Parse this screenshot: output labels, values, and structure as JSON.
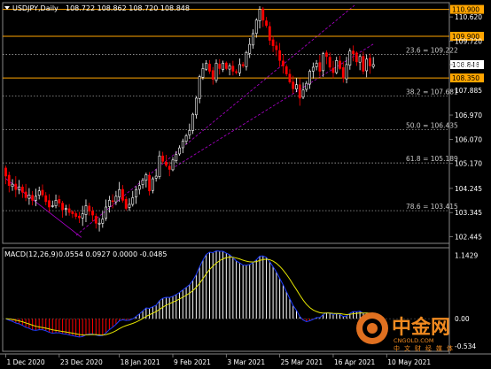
{
  "header": {
    "symbol": "USDJPY,Daily",
    "ohlc": "108.722 108.862 108.720 108.848"
  },
  "macd_header": {
    "label": "MACD(12,26,9)",
    "values": "0.0554 0.0927 0.0000 -0.0485"
  },
  "watermark": {
    "brand": "中金网",
    "domain": "CNGOLD.COM",
    "tagline": "中文财经媒体"
  },
  "colors": {
    "background": "#000000",
    "bull_candle": "#ffffff",
    "bear_candle": "#ff0000",
    "level_line": "#ffa500",
    "channel": "#b000d0",
    "macd_line": "#1e3cff",
    "signal_line": "#e6e600",
    "hist_pos": "#ffffff",
    "hist_neg": "#ff0000"
  },
  "chart_data": {
    "type": "candlestick",
    "symbol": "USDJPY",
    "timeframe": "Daily",
    "ylim": [
      102.2,
      111.15
    ],
    "price_axis_ticks": [
      "110.620",
      "109.720",
      "108.848",
      "107.885",
      "106.970",
      "106.070",
      "105.170",
      "104.245",
      "103.345",
      "102.445"
    ],
    "x_ticks": [
      "1 Dec 2020",
      "23 Dec 2020",
      "18 Jan 2021",
      "9 Feb 2021",
      "3 Mar 2021",
      "25 Mar 2021",
      "16 Apr 2021",
      "10 May 2021"
    ],
    "current_price": "108.848",
    "horizontal_levels": [
      {
        "value": 110.9,
        "label": "110.900"
      },
      {
        "value": 109.9,
        "label": "109.900"
      },
      {
        "value": 108.35,
        "label": "108.350"
      }
    ],
    "fibonacci_levels": [
      {
        "ratio": "23.6",
        "value": 109.222,
        "label": "23.6 = 109.222"
      },
      {
        "ratio": "38.2",
        "value": 107.681,
        "label": "38.2 = 107.681"
      },
      {
        "ratio": "50.0",
        "value": 106.435,
        "label": "50.0 = 106.435"
      },
      {
        "ratio": "61.8",
        "value": 105.189,
        "label": "61.8 = 105.189"
      },
      {
        "ratio": "78.6",
        "value": 103.415,
        "label": "78.6 = 103.415"
      }
    ],
    "channel_lines": [
      {
        "from": [
          1,
          104.62
        ],
        "to": [
          88,
          102.42
        ]
      },
      {
        "from": [
          82,
          102.5
        ],
        "to": [
          400,
          111.05
        ]
      },
      {
        "from": [
          195,
          105.05
        ],
        "to": [
          422,
          109.62
        ]
      }
    ],
    "closes": [
      104.7,
      104.35,
      104.4,
      104.2,
      104.3,
      104.1,
      103.9,
      104.0,
      103.8,
      103.95,
      104.15,
      104.0,
      103.75,
      103.55,
      103.6,
      103.8,
      103.7,
      103.45,
      103.5,
      103.35,
      103.3,
      103.2,
      103.15,
      103.3,
      103.6,
      103.4,
      103.25,
      102.95,
      102.95,
      103.1,
      103.55,
      103.8,
      103.75,
      103.95,
      104.2,
      103.8,
      103.5,
      103.65,
      103.9,
      104.2,
      104.35,
      104.55,
      104.75,
      104.15,
      104.6,
      104.7,
      105.45,
      105.25,
      105.1,
      104.95,
      105.3,
      105.5,
      105.75,
      106.0,
      106.2,
      106.4,
      107.0,
      107.6,
      108.4,
      108.7,
      108.9,
      108.6,
      108.3,
      108.9,
      108.7,
      108.9,
      108.7,
      108.8,
      108.6,
      108.55,
      108.85,
      108.8,
      109.3,
      109.6,
      110.0,
      110.5,
      110.9,
      110.5,
      110.3,
      109.75,
      109.55,
      109.4,
      109.0,
      108.8,
      108.5,
      108.2,
      107.95,
      108.1,
      107.6,
      107.9,
      108.15,
      108.6,
      108.75,
      108.9,
      108.6,
      109.25,
      109.15,
      108.75,
      108.55,
      109.0,
      108.7,
      108.35,
      108.85,
      109.35,
      109.25,
      108.95,
      109.15,
      108.6,
      109.05,
      108.8,
      108.85
    ],
    "macd": {
      "params": "12,26,9",
      "values": {
        "macd": 0.0554,
        "signal": 0.0927,
        "extra": 0.0,
        "histogram": -0.0485
      },
      "ylim": [
        -0.55,
        1.2
      ],
      "axis_labels": [
        "1.1429",
        "0.00",
        "-0.534"
      ]
    }
  }
}
